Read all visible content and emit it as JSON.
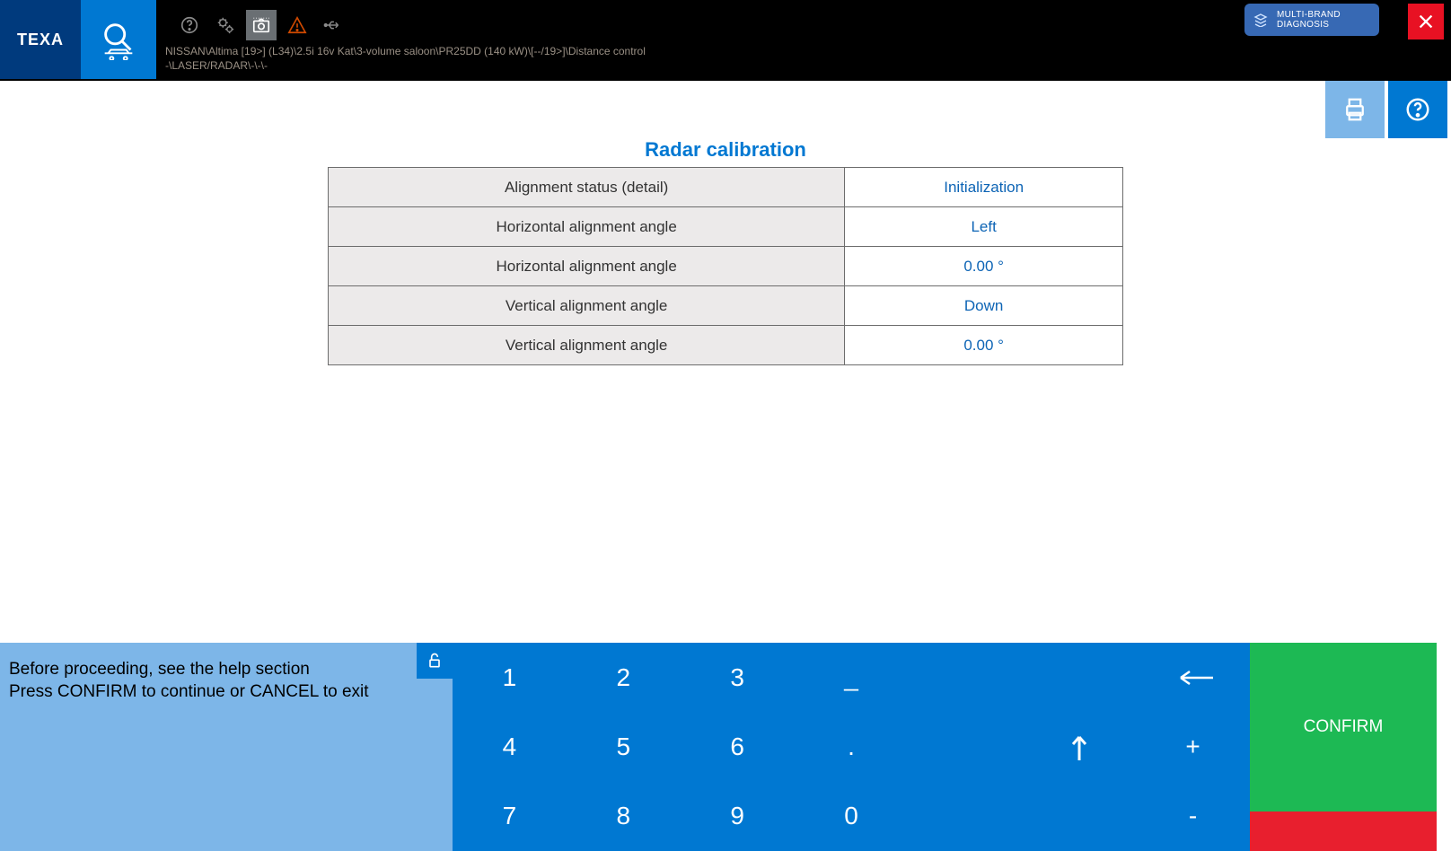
{
  "brand": "TEXA",
  "toolbar": {
    "breadcrumb_line1": "NISSAN\\Altima [19>] (L34)\\2.5i 16v Kat\\3-volume saloon\\PR25DD (140 kW)\\[--/19>]\\Distance control",
    "breadcrumb_line2": "-\\LASER/RADAR\\-\\-\\-"
  },
  "badge": {
    "line1": "MULTI-BRAND",
    "line2": "DIAGNOSIS"
  },
  "main": {
    "title": "Radar calibration",
    "rows": [
      {
        "label": "Alignment status (detail)",
        "value": "Initialization"
      },
      {
        "label": "Horizontal alignment angle",
        "value": "Left"
      },
      {
        "label": "Horizontal alignment angle",
        "value": "0.00 °"
      },
      {
        "label": "Vertical alignment angle",
        "value": "Down"
      },
      {
        "label": "Vertical alignment angle",
        "value": "0.00 °"
      }
    ]
  },
  "instructions": {
    "line1": "Before proceeding, see the help section",
    "line2": "Press CONFIRM to continue or CANCEL to exit"
  },
  "keypad": {
    "row1": [
      "1",
      "2",
      "3",
      "_"
    ],
    "row2": [
      "4",
      "5",
      "6",
      ".",
      "+"
    ],
    "row3": [
      "7",
      "8",
      "9",
      "0",
      "-"
    ]
  },
  "actions": {
    "confirm": "CONFIRM"
  },
  "icons": {
    "help": "help-icon",
    "settings": "settings-icon",
    "camera": "camera-icon",
    "warning": "warning-icon",
    "usb": "usb-icon",
    "print": "print-icon",
    "help2": "help-circle-icon",
    "close": "close-icon",
    "lock": "lock-icon",
    "search": "search-vehicle-icon",
    "backspace": "backspace-icon",
    "arrow_up": "arrow-up-icon",
    "multi_brand": "stacked-layers-icon"
  },
  "colors": {
    "brand_blue": "#0078d2",
    "dark_blue": "#003a7d",
    "badge_blue": "#3769b4",
    "light_blue": "#7db6e8",
    "green": "#1db954",
    "red": "#e81123"
  }
}
